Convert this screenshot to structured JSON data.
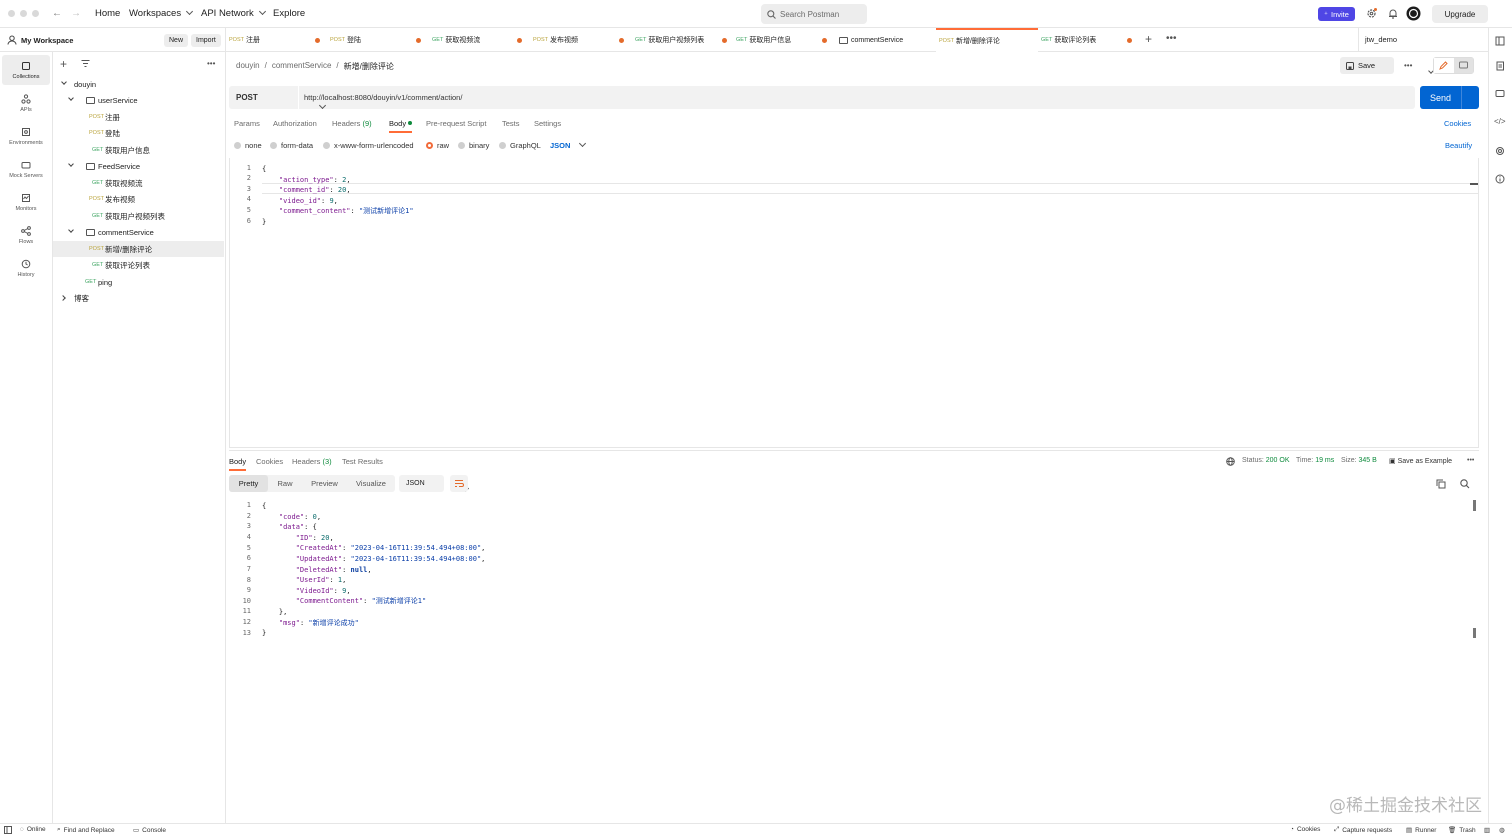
{
  "topbar": {
    "nav": [
      "Home",
      "Workspaces",
      "API Network",
      "Explore"
    ],
    "search_placeholder": "Search Postman",
    "invite_label": "Invite",
    "upgrade_label": "Upgrade"
  },
  "workspace": {
    "name": "My Workspace",
    "new_label": "New",
    "import_label": "Import"
  },
  "tabs": [
    {
      "method": "POST",
      "label": "注册"
    },
    {
      "method": "POST",
      "label": "登陆"
    },
    {
      "method": "GET",
      "label": "获取视频流"
    },
    {
      "method": "POST",
      "label": "发布视频"
    },
    {
      "method": "GET",
      "label": "获取用户视频列表"
    },
    {
      "method": "GET",
      "label": "获取用户信息"
    },
    {
      "method": "",
      "label": "commentService"
    },
    {
      "method": "POST",
      "label": "新增/删除评论"
    },
    {
      "method": "GET",
      "label": "获取评论列表"
    }
  ],
  "environment": "jtw_demo",
  "rail": [
    "Collections",
    "APIs",
    "Environments",
    "Mock Servers",
    "Monitors",
    "Flows",
    "History"
  ],
  "tree": {
    "root": "douyin",
    "userService": "userService",
    "feedService": "FeedService",
    "commentService": "commentService",
    "items": [
      {
        "method": "POST",
        "label": "注册"
      },
      {
        "method": "POST",
        "label": "登陆"
      },
      {
        "method": "GET",
        "label": "获取用户信息"
      },
      {
        "method": "GET",
        "label": "获取视频流"
      },
      {
        "method": "POST",
        "label": "发布视频"
      },
      {
        "method": "GET",
        "label": "获取用户视频列表"
      },
      {
        "method": "POST",
        "label": "新增/删除评论"
      },
      {
        "method": "GET",
        "label": "获取评论列表"
      },
      {
        "method": "GET",
        "label": "ping"
      }
    ],
    "other": "博客"
  },
  "request": {
    "breadcrumb": [
      "douyin",
      "commentService",
      "新增/删除评论"
    ],
    "save_label": "Save",
    "method": "POST",
    "url": "http://localhost:8080/douyin/v1/comment/action/",
    "send_label": "Send",
    "subtabs": [
      "Params",
      "Authorization",
      "Headers",
      "(9)",
      "Body",
      "Pre-request Script",
      "Tests",
      "Settings"
    ],
    "cookies_label": "Cookies",
    "body_types": [
      "none",
      "form-data",
      "x-www-form-urlencoded",
      "raw",
      "binary",
      "GraphQL"
    ],
    "body_format": "JSON",
    "beautify_label": "Beautify",
    "line_numbers": [
      "1",
      "2",
      "3",
      "4",
      "5",
      "6"
    ]
  },
  "response": {
    "tabs": [
      "Body",
      "Cookies",
      "Headers",
      "(3)",
      "Test Results"
    ],
    "status_label": "Status:",
    "status_value": "200 OK",
    "time_label": "Time:",
    "time_value": "19 ms",
    "size_label": "Size:",
    "size_value": "345 B",
    "save_example": "Save as Example",
    "views": [
      "Pretty",
      "Raw",
      "Preview",
      "Visualize"
    ],
    "format": "JSON",
    "line_numbers": [
      "1",
      "2",
      "3",
      "4",
      "5",
      "6",
      "7",
      "8",
      "9",
      "10",
      "11",
      "12",
      "13"
    ]
  },
  "footer": [
    "Online",
    "Find and Replace",
    "Console",
    "Cookies",
    "Capture requests",
    "Runner",
    "Trash"
  ],
  "watermark": "@稀土掘金技术社区",
  "colors": {
    "accent": "#ff6c37",
    "send": "#0265d2",
    "invite": "#4f46e5",
    "status_ok": "#0d8a3c"
  }
}
